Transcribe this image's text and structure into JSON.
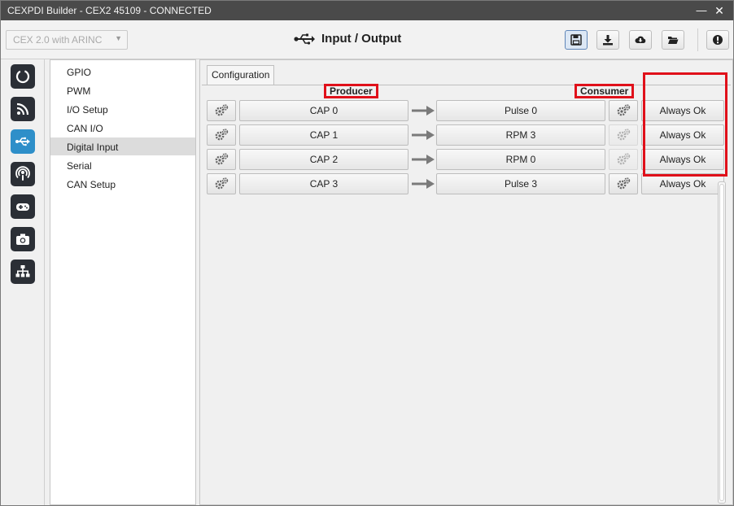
{
  "window": {
    "title": "CEXPDI Builder - CEX2 45109 - CONNECTED",
    "minimize_glyph": "—",
    "close_glyph": "✕"
  },
  "toolbar": {
    "device_select_value": "CEX 2.0 with ARINC",
    "page_title": "Input / Output",
    "buttons": [
      "save-icon",
      "download-icon",
      "cloud-download-icon",
      "folder-open-icon",
      "info-icon"
    ]
  },
  "iconbar": {
    "items": [
      "power-icon",
      "rss-icon",
      "usb-icon",
      "podcast-icon",
      "gamepad-icon",
      "camera-icon",
      "sitemap-icon"
    ],
    "active": "usb-icon"
  },
  "submenu": {
    "items": [
      {
        "label": "GPIO"
      },
      {
        "label": "PWM"
      },
      {
        "label": "I/O Setup"
      },
      {
        "label": "CAN I/O"
      },
      {
        "label": "Digital Input"
      },
      {
        "label": "Serial"
      },
      {
        "label": "CAN Setup"
      }
    ],
    "selected": "Digital Input"
  },
  "content": {
    "tab_label": "Configuration",
    "producer_label": "Producer",
    "consumer_label": "Consumer",
    "rows": [
      {
        "producer": "CAP 0",
        "consumer": "Pulse 0",
        "status": "Always Ok",
        "consumer_gear_enabled": true
      },
      {
        "producer": "CAP 1",
        "consumer": "RPM 3",
        "status": "Always Ok",
        "consumer_gear_enabled": false
      },
      {
        "producer": "CAP 2",
        "consumer": "RPM 0",
        "status": "Always Ok",
        "consumer_gear_enabled": false
      },
      {
        "producer": "CAP 3",
        "consumer": "Pulse 3",
        "status": "Always Ok",
        "consumer_gear_enabled": true
      }
    ]
  },
  "colors": {
    "titlebar": "#4a4a4a",
    "accent": "#2e8fc9",
    "annotation_red": "#e0101a",
    "icon_dark": "#2b2f36"
  }
}
